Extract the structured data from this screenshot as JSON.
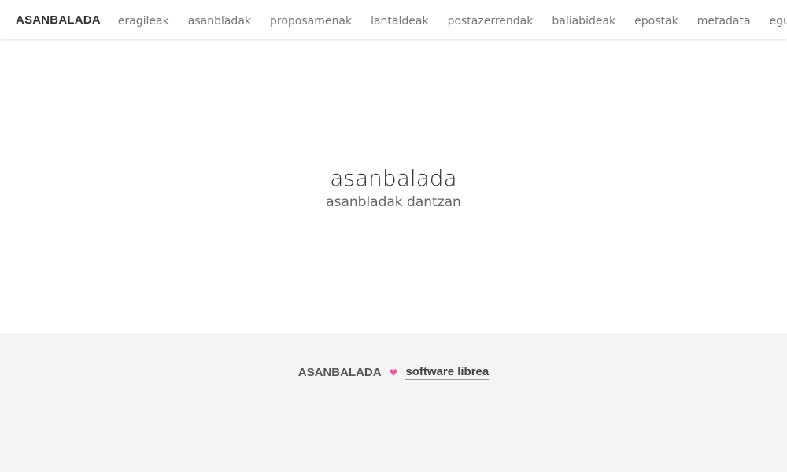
{
  "navbar": {
    "brand": "ASANBALADA",
    "items": [
      {
        "label": "eragileak"
      },
      {
        "label": "asanbladak"
      },
      {
        "label": "proposamenak"
      },
      {
        "label": "lantaldeak"
      },
      {
        "label": "postazerrendak"
      },
      {
        "label": "baliabideak"
      },
      {
        "label": "epostak"
      },
      {
        "label": "metadata"
      },
      {
        "label": "egutegia"
      }
    ]
  },
  "hero": {
    "title": "asanbalada",
    "subtitle": "asanbladak dantzan"
  },
  "footer": {
    "brand": "ASANBALADA",
    "heart": "♥",
    "link_label": "software librea"
  },
  "colors": {
    "heart": "#e85c9e",
    "footer_bg": "#f4f4f4",
    "nav_text": "#777777"
  }
}
